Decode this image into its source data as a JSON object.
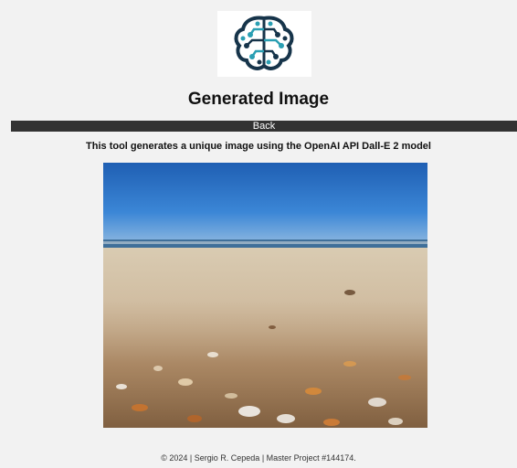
{
  "header": {
    "logo_icon": "brain-circuit-icon",
    "title": "Generated Image"
  },
  "nav": {
    "back_label": "Back"
  },
  "main": {
    "description": "This tool generates a unique image using the OpenAI API Dall-E 2 model",
    "image_subject": "beach-with-shells-image"
  },
  "footer": {
    "text": "© 2024 | Sergio R. Cepeda | Master Project #144174."
  },
  "colors": {
    "background": "#f2f2f2",
    "bar": "#333333",
    "logo_teal": "#2a9fb3",
    "logo_dark": "#16344a"
  }
}
